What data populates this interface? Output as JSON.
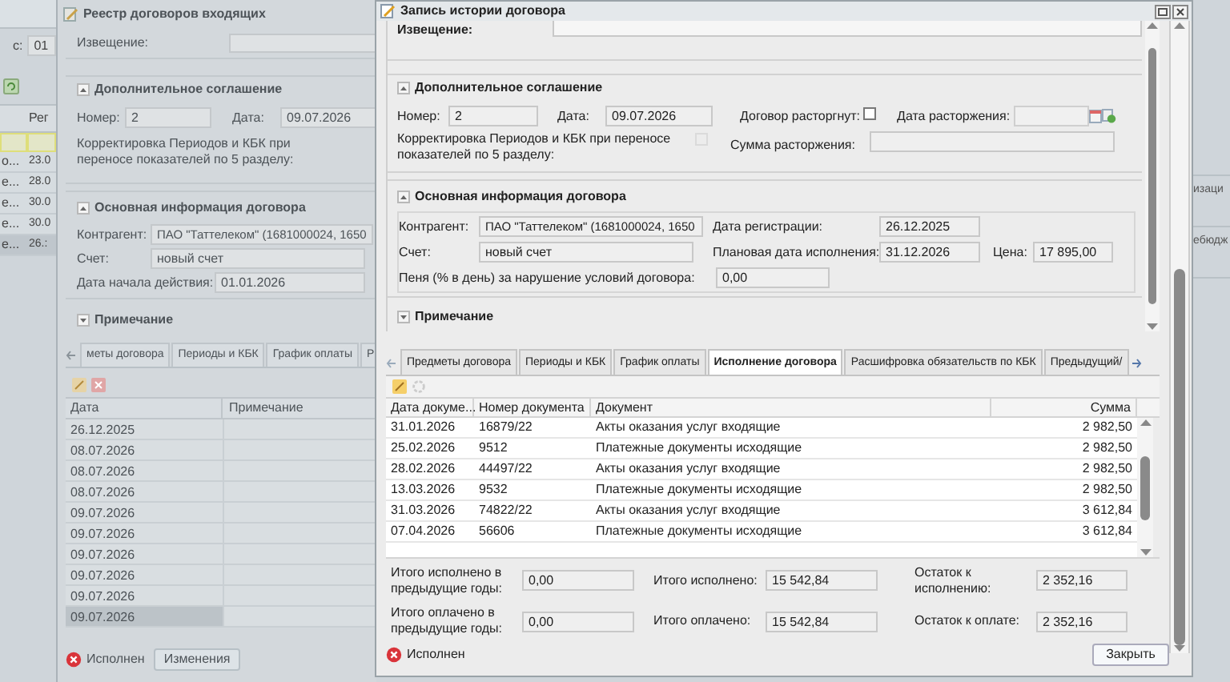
{
  "left_app": {
    "filter_label": "с:",
    "filter_value": "01",
    "column": "Рег",
    "rows": [
      {
        "name": "о...",
        "date": "23.0",
        "selected": false
      },
      {
        "name": "е...",
        "date": "28.0",
        "selected": false
      },
      {
        "name": "е...",
        "date": "30.0",
        "selected": false
      },
      {
        "name": "е...",
        "date": "30.0",
        "selected": false
      },
      {
        "name": "е...",
        "date": "26.:",
        "selected": true
      }
    ]
  },
  "right_app": {
    "texts": [
      "изаци",
      "ебюдж"
    ]
  },
  "registry_window": {
    "title": "Реестр договоров входящих",
    "notice_label": "Извещение:",
    "agreement": {
      "title": "Дополнительное соглашение",
      "expanded": true,
      "number_label": "Номер:",
      "number": "2",
      "date_label": "Дата:",
      "date": "09.07.2026",
      "correction_label": "Корректировка Периодов и КБК при переносе показателей по 5 разделу:"
    },
    "main_info": {
      "title": "Основная информация договора",
      "expanded": true,
      "counterparty_label": "Контрагент:",
      "counterparty": "ПАО \"Таттелеком\" (1681000024, 1650",
      "account_label": "Счет:",
      "account": "новый счет",
      "start_label": "Дата начала действия:",
      "start": "01.01.2026"
    },
    "note": {
      "title": "Примечание",
      "expanded": false
    },
    "tabs": [
      {
        "label": "меты договора",
        "selected": false
      },
      {
        "label": "Периоды и КБК",
        "selected": false
      },
      {
        "label": "График оплаты",
        "selected": false
      },
      {
        "label": "Р",
        "selected": false
      }
    ],
    "table": {
      "columns": [
        "Дата",
        "Примечание"
      ],
      "rows": [
        {
          "date": "26.12.2025",
          "selected": false
        },
        {
          "date": "08.07.2026",
          "selected": false
        },
        {
          "date": "08.07.2026",
          "selected": false
        },
        {
          "date": "08.07.2026",
          "selected": false
        },
        {
          "date": "09.07.2026",
          "selected": false
        },
        {
          "date": "09.07.2026",
          "selected": false
        },
        {
          "date": "09.07.2026",
          "selected": false
        },
        {
          "date": "09.07.2026",
          "selected": false
        },
        {
          "date": "09.07.2026",
          "selected": false
        },
        {
          "date": "09.07.2026",
          "selected": true
        }
      ]
    },
    "status": "Исполнен",
    "button": "Изменения"
  },
  "dialog": {
    "title": "Запись истории договора",
    "notice_label": "Извещение:",
    "agreement": {
      "title": "Дополнительное соглашение",
      "expanded": true,
      "number_label": "Номер:",
      "number": "2",
      "date_label": "Дата:",
      "date": "09.07.2026",
      "terminated_label": "Договор расторгнут:",
      "terminated": false,
      "termination_date_label": "Дата расторжения:",
      "correction_label": "Корректировка Периодов и КБК при переносе показателей по 5 разделу:",
      "correction_checked": false,
      "termination_sum_label": "Сумма расторжения:"
    },
    "main_info": {
      "title": "Основная информация договора",
      "expanded": true,
      "counterparty_label": "Контрагент:",
      "counterparty": "ПАО \"Таттелеком\" (1681000024, 1650",
      "account_label": "Счет:",
      "account": "новый счет",
      "penalty_label": "Пеня (% в день) за нарушение условий договора:",
      "penalty": "0,00",
      "reg_date_label": "Дата регистрации:",
      "reg_date": "26.12.2025",
      "planned_label": "Плановая дата исполнения:",
      "planned": "31.12.2026",
      "price_label": "Цена:",
      "price": "17 895,00"
    },
    "note": {
      "title": "Примечание",
      "expanded": false
    },
    "tabs": [
      {
        "label": "Предметы договора",
        "selected": false
      },
      {
        "label": "Периоды и КБК",
        "selected": false
      },
      {
        "label": "График оплаты",
        "selected": false
      },
      {
        "label": "Исполнение договора",
        "selected": true
      },
      {
        "label": "Расшифровка обязательств по КБК",
        "selected": false
      },
      {
        "label": "Предыдущий/",
        "selected": false
      }
    ],
    "table": {
      "columns": [
        "Дата докуме...",
        "Номер документа",
        "Документ",
        "Сумма"
      ],
      "rows": [
        {
          "date": "31.01.2026",
          "number": "16879/22",
          "document": "Акты оказания услуг входящие",
          "sum": "2 982,50"
        },
        {
          "date": "25.02.2026",
          "number": "9512",
          "document": "Платежные документы исходящие",
          "sum": "2 982,50"
        },
        {
          "date": "28.02.2026",
          "number": "44497/22",
          "document": "Акты оказания услуг входящие",
          "sum": "2 982,50"
        },
        {
          "date": "13.03.2026",
          "number": "9532",
          "document": "Платежные документы исходящие",
          "sum": "2 982,50"
        },
        {
          "date": "31.03.2026",
          "number": "74822/22",
          "document": "Акты оказания услуг входящие",
          "sum": "3 612,84"
        },
        {
          "date": "07.04.2026",
          "number": "56606",
          "document": "Платежные документы исходящие",
          "sum": "3 612,84"
        }
      ]
    },
    "totals": [
      {
        "label": "Итого исполнено в предыдущие годы:",
        "value": "0,00"
      },
      {
        "label": "Итого исполнено:",
        "value": "15 542,84"
      },
      {
        "label": "Остаток к исполнению:",
        "value": "2 352,16"
      },
      {
        "label": "Итого оплачено в предыдущие годы:",
        "value": "0,00"
      },
      {
        "label": "Итого оплачено:",
        "value": "15 542,84"
      },
      {
        "label": "Остаток к оплате:",
        "value": "2 352,16"
      }
    ],
    "status": "Исполнен",
    "button": "Закрыть"
  }
}
